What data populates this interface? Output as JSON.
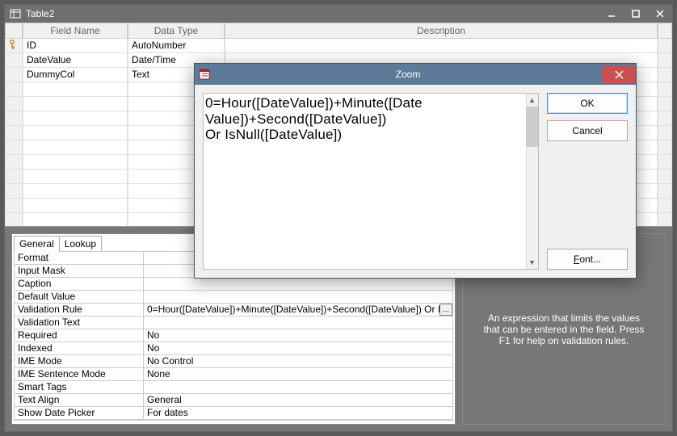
{
  "window": {
    "title": "Table2"
  },
  "grid": {
    "columns": {
      "field": "Field Name",
      "type": "Data Type",
      "desc": "Description"
    },
    "rows": [
      {
        "pk": true,
        "field": "ID",
        "type": "AutoNumber",
        "desc": ""
      },
      {
        "pk": false,
        "field": "DateValue",
        "type": "Date/Time",
        "desc": ""
      },
      {
        "pk": false,
        "field": "DummyCol",
        "type": "Text",
        "desc": ""
      }
    ]
  },
  "tabs": {
    "general": "General",
    "lookup": "Lookup"
  },
  "props": {
    "format": {
      "label": "Format",
      "value": ""
    },
    "input_mask": {
      "label": "Input Mask",
      "value": ""
    },
    "caption": {
      "label": "Caption",
      "value": ""
    },
    "default_value": {
      "label": "Default Value",
      "value": ""
    },
    "validation_rule": {
      "label": "Validation Rule",
      "value": "0=Hour([DateValue])+Minute([DateValue])+Second([DateValue]) Or IsNull([DateValue])"
    },
    "validation_text": {
      "label": "Validation Text",
      "value": ""
    },
    "required": {
      "label": "Required",
      "value": "No"
    },
    "indexed": {
      "label": "Indexed",
      "value": "No"
    },
    "ime_mode": {
      "label": "IME Mode",
      "value": "No Control"
    },
    "ime_sentence_mode": {
      "label": "IME Sentence Mode",
      "value": "None"
    },
    "smart_tags": {
      "label": "Smart Tags",
      "value": ""
    },
    "text_align": {
      "label": "Text Align",
      "value": "General"
    },
    "show_date_picker": {
      "label": "Show Date Picker",
      "value": "For dates"
    }
  },
  "help_text": "An expression that limits the values that can be entered in the field. Press F1 for help on validation rules.",
  "zoom": {
    "title": "Zoom",
    "text_l1": "0=Hour([DateValue])+Minute([Date",
    "text_l2": "Value])+Second([DateValue])",
    "text_l3": "Or IsNull([DateValue])",
    "ok": "OK",
    "cancel": "Cancel",
    "font": "ont..."
  },
  "build_btn": "..."
}
